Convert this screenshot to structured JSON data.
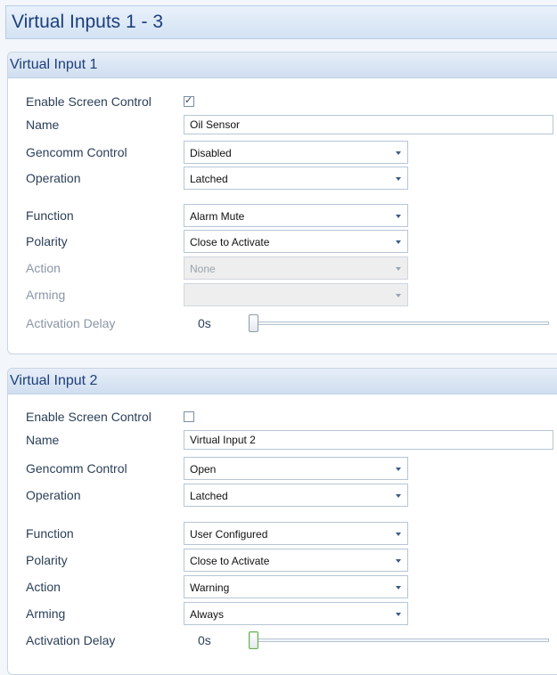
{
  "page_title": "Virtual Inputs 1 - 3",
  "labels": {
    "enable_screen_control": "Enable Screen Control",
    "name": "Name",
    "gencomm_control": "Gencomm Control",
    "operation": "Operation",
    "function": "Function",
    "polarity": "Polarity",
    "action": "Action",
    "arming": "Arming",
    "activation_delay": "Activation Delay"
  },
  "groups": [
    {
      "title": "Virtual Input 1",
      "enable_screen_control": true,
      "name": "Oil Sensor",
      "gencomm_control": "Disabled",
      "operation": "Latched",
      "function": "Alarm Mute",
      "polarity": "Close to Activate",
      "action": "None",
      "arming": "",
      "action_enabled": false,
      "arming_enabled": false,
      "activation_delay": "0s",
      "slider_value": 0
    },
    {
      "title": "Virtual Input 2",
      "enable_screen_control": false,
      "name": "Virtual Input 2",
      "gencomm_control": "Open",
      "operation": "Latched",
      "function": "User Configured",
      "polarity": "Close to Activate",
      "action": "Warning",
      "arming": "Always",
      "action_enabled": true,
      "arming_enabled": true,
      "activation_delay": "0s",
      "slider_value": 0
    }
  ]
}
